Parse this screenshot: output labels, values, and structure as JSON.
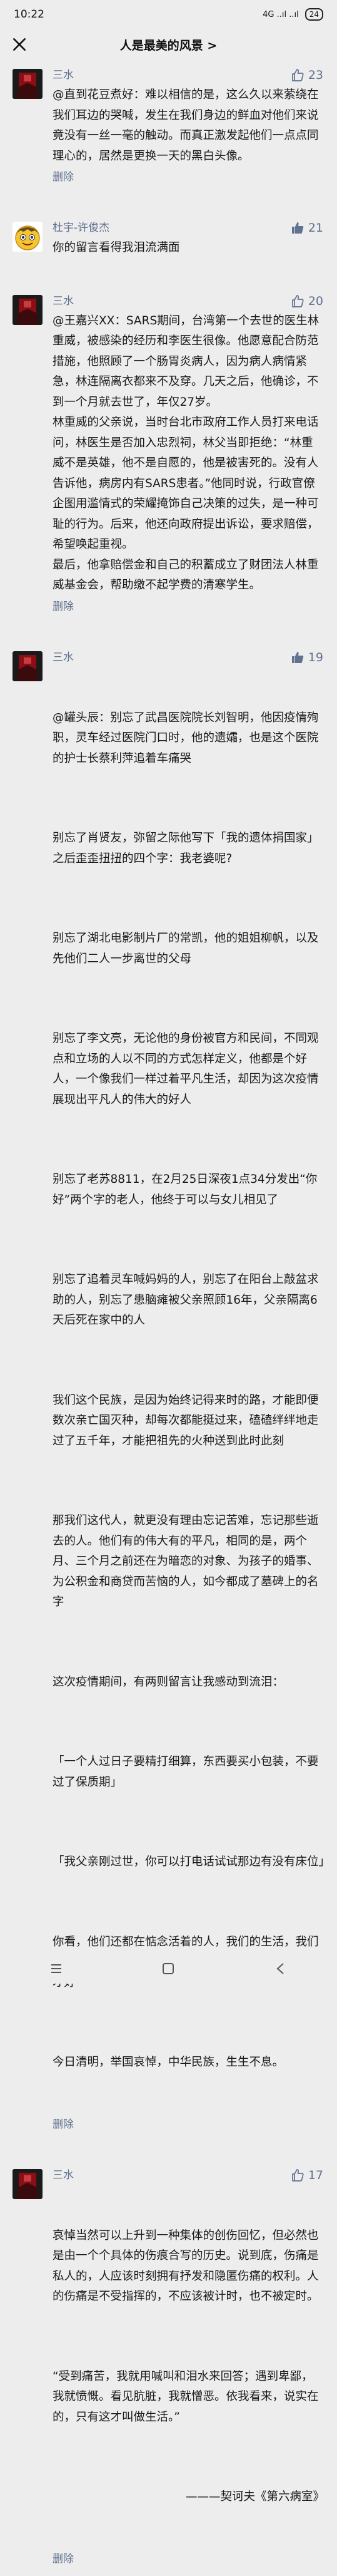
{
  "status": {
    "time": "10:22",
    "signal": "4G ..ıl ..ıl",
    "battery": "24"
  },
  "header": {
    "title": "人是最美的风景 >"
  },
  "comments": [
    {
      "name": "三水",
      "likes": "23",
      "text": "@直到花豆煮好：难以相信的是，这么久以来萦绕在我们耳边的哭喊，发生在我们身边的鲜血对他们来说竟没有一丝一毫的触动。而真正激发起他们一点点同理心的，居然是更换一天的黑白头像。",
      "delete": "删除"
    },
    {
      "name": "杜宇-许俊杰",
      "likes": "21",
      "text": "你的留言看得我泪流满面"
    },
    {
      "name": "三水",
      "likes": "20",
      "text": "@王嘉兴XX：SARS期间，台湾第一个去世的医生林重威，被感染的经历和李医生很像。他愿意配合防范措施，他照顾了一个肠胃炎病人，因为病人病情紧急，林连隔离衣都来不及穿。几天之后，他确诊，不到一个月就去世了，年仅27岁。\n林重威的父亲说，当时台北市政府工作人员打来电话问，林医生是否加入忠烈祠，林父当即拒绝：“林重威不是英雄，他不是自愿的，他是被害死的。没有人告诉他，病房内有SARS患者。”他同时说，行政官僚企图用滥情式的荣耀掩饰自己决策的过失，是一种可耻的行为。后来，他还向政府提出诉讼，要求赔偿，希望唤起重视。\n最后，他拿赔偿金和自己的积蓄成立了财团法人林重威基金会，帮助缴不起学费的清寒学生。",
      "delete": "删除"
    },
    {
      "name": "三水",
      "likes": "19",
      "paras": [
        "@罐头辰：别忘了武昌医院院长刘智明，他因疫情殉职，灵车经过医院门口时，他的遗孀，也是这个医院的护士长蔡利萍追着车痛哭",
        "别忘了肖贤友，弥留之际他写下「我的遗体捐国家」之后歪歪扭扭的四个字：我老婆呢?",
        "别忘了湖北电影制片厂的常凯，他的姐姐柳帆，以及先他们二人一步离世的父母",
        "别忘了李文亮，无论他的身份被官方和民间，不同观点和立场的人以不同的方式怎样定义，他都是个好人，一个像我们一样过着平凡生活，却因为这次疫情展现出平凡人的伟大的好人",
        "别忘了老苏8811，在2月25日深夜1点34分发出“你好”两个字的老人，他终于可以与女儿相见了",
        "别忘了追着灵车喊妈妈的人，别忘了在阳台上敲盆求助的人，别忘了患脑瘫被父亲照顾16年，父亲隔离6天后死在家中的人",
        "我们这个民族，是因为始终记得来时的路，才能即便数次亲亡国灭种，却每次都能挺过来，磕磕绊绊地走过了五千年，才能把祖先的火种送到此时此刻",
        "那我们这代人，就更没有理由忘记苦难，忘记那些逝去的人。他们有的伟大有的平凡，相同的是，两个月、三个月之前还在为暗恋的对象、为孩子的婚事、为公积金和商贷而苦恼的人，如今都成了墓碑上的名字",
        "这次疫情期间，有两则留言让我感动到流泪：",
        "「一个人过日子要精打细算，东西要买小包装，不要过了保质期」",
        "「我父亲刚过世，你可以打电话试试那边有没有床位」",
        "你看，他们还都在惦念活着的人，我们的生活，我们的民族，我们的国家，一定要对得起他们生前的牵挂才好",
        "今日清明，举国哀悼，中华民族，生生不息。"
      ],
      "delete": "删除"
    },
    {
      "name": "三水",
      "likes": "17",
      "paras": [
        "哀悼当然可以上升到一种集体的创伤回忆，但必然也是由一个个具体的伤痕合写的历史。说到底，伤痛是私人的，人应该时刻拥有抒发和隐匿伤痛的权利。人的伤痛是不受指挥的，不应该被计时，也不被定时。",
        "“受到痛苦，我就用喊叫和泪水来回答；遇到卑鄙，我就愤慨。看见肮脏，我就憎恶。依我看来，说实在的，只有这才叫做生活。”"
      ],
      "sign": "———契诃夫《第六病室》",
      "delete": "删除"
    }
  ],
  "colors": {
    "accent": "#5f7290",
    "background": "#ededed",
    "avatar_red": "#8b0e16"
  }
}
